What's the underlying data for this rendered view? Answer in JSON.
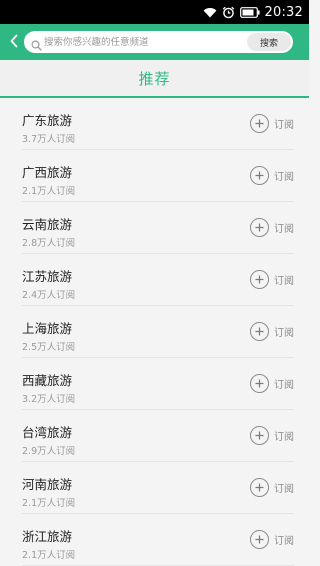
{
  "status_bar": {
    "time": "20:32",
    "icons": [
      "wifi-icon",
      "alarm-icon",
      "battery-icon"
    ]
  },
  "search": {
    "placeholder": "搜索你感兴趣的任意频道",
    "button_label": "搜索"
  },
  "section": {
    "title": "推荐"
  },
  "channels": [
    {
      "name": "广东旅游",
      "subscribers": "3.7万人订阅",
      "action": "订阅"
    },
    {
      "name": "广西旅游",
      "subscribers": "2.1万人订阅",
      "action": "订阅"
    },
    {
      "name": "云南旅游",
      "subscribers": "2.8万人订阅",
      "action": "订阅"
    },
    {
      "name": "江苏旅游",
      "subscribers": "2.4万人订阅",
      "action": "订阅"
    },
    {
      "name": "上海旅游",
      "subscribers": "2.5万人订阅",
      "action": "订阅"
    },
    {
      "name": "西藏旅游",
      "subscribers": "3.2万人订阅",
      "action": "订阅"
    },
    {
      "name": "台湾旅游",
      "subscribers": "2.9万人订阅",
      "action": "订阅"
    },
    {
      "name": "河南旅游",
      "subscribers": "2.1万人订阅",
      "action": "订阅"
    },
    {
      "name": "浙江旅游",
      "subscribers": "2.1万人订阅",
      "action": "订阅"
    }
  ],
  "colors": {
    "accent": "#2fb884",
    "background": "#f4f4f4"
  }
}
